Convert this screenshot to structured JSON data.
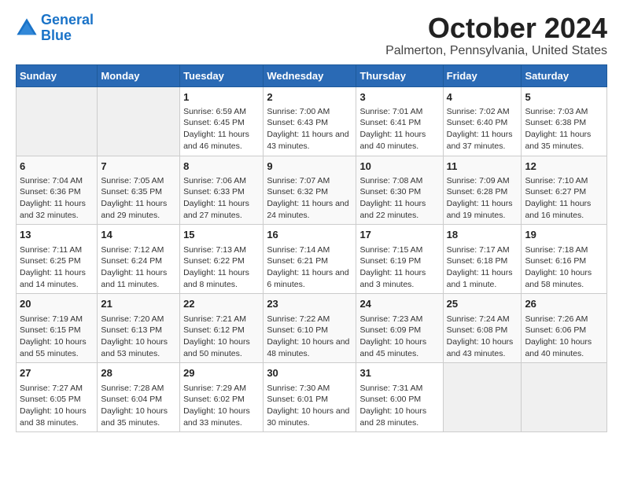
{
  "logo": {
    "line1": "General",
    "line2": "Blue"
  },
  "header": {
    "month": "October 2024",
    "location": "Palmerton, Pennsylvania, United States"
  },
  "days_of_week": [
    "Sunday",
    "Monday",
    "Tuesday",
    "Wednesday",
    "Thursday",
    "Friday",
    "Saturday"
  ],
  "weeks": [
    [
      {
        "num": "",
        "info": ""
      },
      {
        "num": "",
        "info": ""
      },
      {
        "num": "1",
        "info": "Sunrise: 6:59 AM\nSunset: 6:45 PM\nDaylight: 11 hours and 46 minutes."
      },
      {
        "num": "2",
        "info": "Sunrise: 7:00 AM\nSunset: 6:43 PM\nDaylight: 11 hours and 43 minutes."
      },
      {
        "num": "3",
        "info": "Sunrise: 7:01 AM\nSunset: 6:41 PM\nDaylight: 11 hours and 40 minutes."
      },
      {
        "num": "4",
        "info": "Sunrise: 7:02 AM\nSunset: 6:40 PM\nDaylight: 11 hours and 37 minutes."
      },
      {
        "num": "5",
        "info": "Sunrise: 7:03 AM\nSunset: 6:38 PM\nDaylight: 11 hours and 35 minutes."
      }
    ],
    [
      {
        "num": "6",
        "info": "Sunrise: 7:04 AM\nSunset: 6:36 PM\nDaylight: 11 hours and 32 minutes."
      },
      {
        "num": "7",
        "info": "Sunrise: 7:05 AM\nSunset: 6:35 PM\nDaylight: 11 hours and 29 minutes."
      },
      {
        "num": "8",
        "info": "Sunrise: 7:06 AM\nSunset: 6:33 PM\nDaylight: 11 hours and 27 minutes."
      },
      {
        "num": "9",
        "info": "Sunrise: 7:07 AM\nSunset: 6:32 PM\nDaylight: 11 hours and 24 minutes."
      },
      {
        "num": "10",
        "info": "Sunrise: 7:08 AM\nSunset: 6:30 PM\nDaylight: 11 hours and 22 minutes."
      },
      {
        "num": "11",
        "info": "Sunrise: 7:09 AM\nSunset: 6:28 PM\nDaylight: 11 hours and 19 minutes."
      },
      {
        "num": "12",
        "info": "Sunrise: 7:10 AM\nSunset: 6:27 PM\nDaylight: 11 hours and 16 minutes."
      }
    ],
    [
      {
        "num": "13",
        "info": "Sunrise: 7:11 AM\nSunset: 6:25 PM\nDaylight: 11 hours and 14 minutes."
      },
      {
        "num": "14",
        "info": "Sunrise: 7:12 AM\nSunset: 6:24 PM\nDaylight: 11 hours and 11 minutes."
      },
      {
        "num": "15",
        "info": "Sunrise: 7:13 AM\nSunset: 6:22 PM\nDaylight: 11 hours and 8 minutes."
      },
      {
        "num": "16",
        "info": "Sunrise: 7:14 AM\nSunset: 6:21 PM\nDaylight: 11 hours and 6 minutes."
      },
      {
        "num": "17",
        "info": "Sunrise: 7:15 AM\nSunset: 6:19 PM\nDaylight: 11 hours and 3 minutes."
      },
      {
        "num": "18",
        "info": "Sunrise: 7:17 AM\nSunset: 6:18 PM\nDaylight: 11 hours and 1 minute."
      },
      {
        "num": "19",
        "info": "Sunrise: 7:18 AM\nSunset: 6:16 PM\nDaylight: 10 hours and 58 minutes."
      }
    ],
    [
      {
        "num": "20",
        "info": "Sunrise: 7:19 AM\nSunset: 6:15 PM\nDaylight: 10 hours and 55 minutes."
      },
      {
        "num": "21",
        "info": "Sunrise: 7:20 AM\nSunset: 6:13 PM\nDaylight: 10 hours and 53 minutes."
      },
      {
        "num": "22",
        "info": "Sunrise: 7:21 AM\nSunset: 6:12 PM\nDaylight: 10 hours and 50 minutes."
      },
      {
        "num": "23",
        "info": "Sunrise: 7:22 AM\nSunset: 6:10 PM\nDaylight: 10 hours and 48 minutes."
      },
      {
        "num": "24",
        "info": "Sunrise: 7:23 AM\nSunset: 6:09 PM\nDaylight: 10 hours and 45 minutes."
      },
      {
        "num": "25",
        "info": "Sunrise: 7:24 AM\nSunset: 6:08 PM\nDaylight: 10 hours and 43 minutes."
      },
      {
        "num": "26",
        "info": "Sunrise: 7:26 AM\nSunset: 6:06 PM\nDaylight: 10 hours and 40 minutes."
      }
    ],
    [
      {
        "num": "27",
        "info": "Sunrise: 7:27 AM\nSunset: 6:05 PM\nDaylight: 10 hours and 38 minutes."
      },
      {
        "num": "28",
        "info": "Sunrise: 7:28 AM\nSunset: 6:04 PM\nDaylight: 10 hours and 35 minutes."
      },
      {
        "num": "29",
        "info": "Sunrise: 7:29 AM\nSunset: 6:02 PM\nDaylight: 10 hours and 33 minutes."
      },
      {
        "num": "30",
        "info": "Sunrise: 7:30 AM\nSunset: 6:01 PM\nDaylight: 10 hours and 30 minutes."
      },
      {
        "num": "31",
        "info": "Sunrise: 7:31 AM\nSunset: 6:00 PM\nDaylight: 10 hours and 28 minutes."
      },
      {
        "num": "",
        "info": ""
      },
      {
        "num": "",
        "info": ""
      }
    ]
  ]
}
